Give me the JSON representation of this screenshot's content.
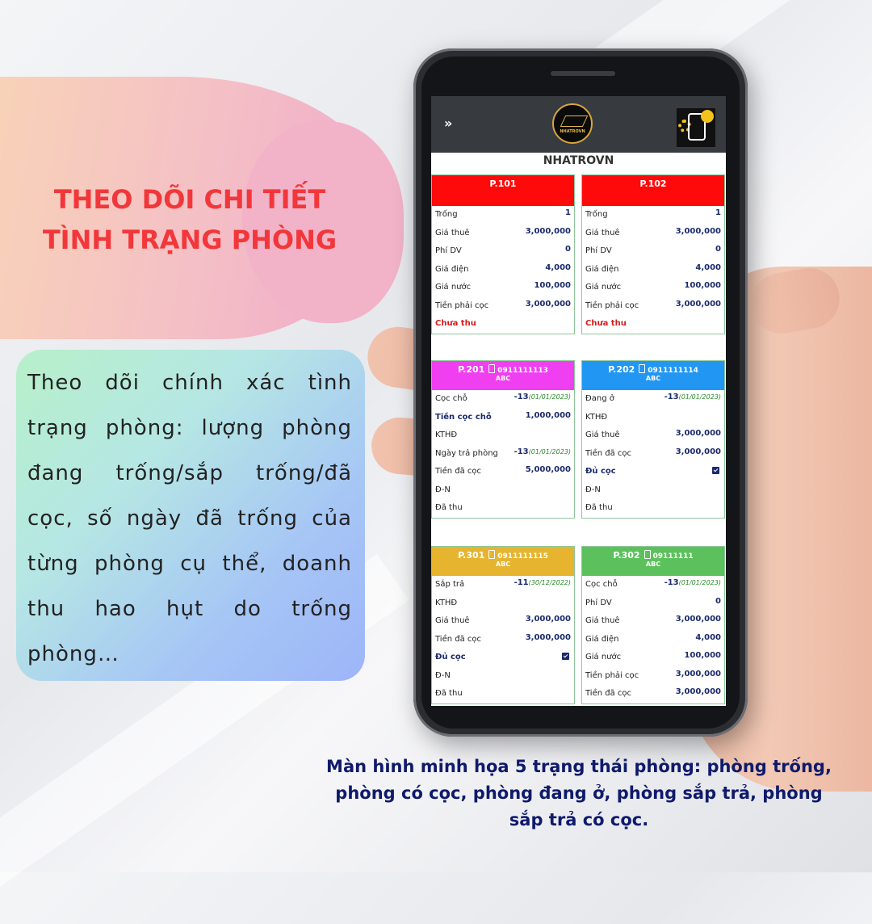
{
  "headline": [
    "THEO DÕI CHI TIẾT",
    "TÌNH TRẠNG PHÒNG"
  ],
  "description": "Theo dõi chính xác tình trạng phòng: lượng phòng đang trống/sắp trống/đã cọc, số ngày đã trống của từng phòng cụ thể, doanh thu hao hụt do trống phòng…",
  "caption": "Màn hình minh họa 5 trạng thái phòng: phòng trống, phòng có cọc, phòng đang ở, phòng sắp trả, phòng sắp trả có cọc.",
  "app": {
    "menu_glyph": "»",
    "logo_text": "NHATROVN",
    "title": "NHATROVN"
  },
  "colors": {
    "vacant": "#ff0a0a",
    "deposited": "#f03ff0",
    "occupied": "#2196f3",
    "leaving": "#e6b42e",
    "leaving_deposit": "#5cc15c"
  },
  "rooms": [
    {
      "name": "P.101",
      "phone": "",
      "sub": "",
      "status": "vacant",
      "rows": [
        {
          "label": "Trống",
          "value": "1"
        },
        {
          "label": "Giá thuê",
          "value": "3,000,000"
        },
        {
          "label": "Phí DV",
          "value": "0"
        },
        {
          "label": "Giá điện",
          "value": "4,000"
        },
        {
          "label": "Giá nước",
          "value": "100,000"
        },
        {
          "label": "Tiền phải cọc",
          "value": "3,000,000"
        },
        {
          "label": "Chưa thu",
          "value": "",
          "style": "red"
        }
      ]
    },
    {
      "name": "P.102",
      "phone": "",
      "sub": "",
      "status": "vacant",
      "rows": [
        {
          "label": "Trống",
          "value": "1"
        },
        {
          "label": "Giá thuê",
          "value": "3,000,000"
        },
        {
          "label": "Phí DV",
          "value": "0"
        },
        {
          "label": "Giá điện",
          "value": "4,000"
        },
        {
          "label": "Giá nước",
          "value": "100,000"
        },
        {
          "label": "Tiền phải cọc",
          "value": "3,000,000"
        },
        {
          "label": "Chưa thu",
          "value": "",
          "style": "red"
        }
      ]
    },
    {
      "name": "P.201",
      "phone": "0911111113",
      "sub": "ABC",
      "status": "deposited",
      "rows": [
        {
          "label": "Cọc chỗ",
          "value": "-13",
          "date": "(01/01/2023)"
        },
        {
          "label": "Tiền cọc chỗ",
          "value": "1,000,000",
          "style": "bold"
        },
        {
          "label": "KTHĐ",
          "value": ""
        },
        {
          "label": "Ngày trả phòng",
          "value": "-13",
          "date": "(01/01/2023)"
        },
        {
          "label": "Tiền đã cọc",
          "value": "5,000,000"
        },
        {
          "label": "Đ-N",
          "value": ""
        },
        {
          "label": "Đã thu",
          "value": ""
        }
      ]
    },
    {
      "name": "P.202",
      "phone": "0911111114",
      "sub": "ABC",
      "status": "occupied",
      "rows": [
        {
          "label": "Đang ở",
          "value": "-13",
          "date": "(01/01/2023)"
        },
        {
          "label": "KTHĐ",
          "value": ""
        },
        {
          "label": "Giá thuê",
          "value": "3,000,000"
        },
        {
          "label": "Tiền đã cọc",
          "value": "3,000,000"
        },
        {
          "label": "Đủ cọc",
          "value": "",
          "style": "bold",
          "check": true
        },
        {
          "label": "Đ-N",
          "value": ""
        },
        {
          "label": "Đã thu",
          "value": ""
        }
      ]
    },
    {
      "name": "P.301",
      "phone": "0911111115",
      "sub": "ABC",
      "status": "leaving",
      "rows": [
        {
          "label": "Sắp trả",
          "value": "-11",
          "date": "(30/12/2022)"
        },
        {
          "label": "KTHĐ",
          "value": ""
        },
        {
          "label": "Giá thuê",
          "value": "3,000,000"
        },
        {
          "label": "Tiền đã cọc",
          "value": "3,000,000"
        },
        {
          "label": "Đủ cọc",
          "value": "",
          "style": "bold",
          "check": true
        },
        {
          "label": "Đ-N",
          "value": ""
        },
        {
          "label": "Đã thu",
          "value": ""
        }
      ]
    },
    {
      "name": "P.302",
      "phone": "09111111",
      "sub": "ABC",
      "status": "leaving_deposit",
      "rows": [
        {
          "label": "Cọc chỗ",
          "value": "-13",
          "date": "(01/01/2023)"
        },
        {
          "label": "Phí DV",
          "value": "0"
        },
        {
          "label": "Giá thuê",
          "value": "3,000,000"
        },
        {
          "label": "Giá điện",
          "value": "4,000"
        },
        {
          "label": "Giá nước",
          "value": "100,000"
        },
        {
          "label": "Tiền phải cọc",
          "value": "3,000,000"
        },
        {
          "label": "Tiền đã cọc",
          "value": "3,000,000"
        }
      ]
    }
  ]
}
